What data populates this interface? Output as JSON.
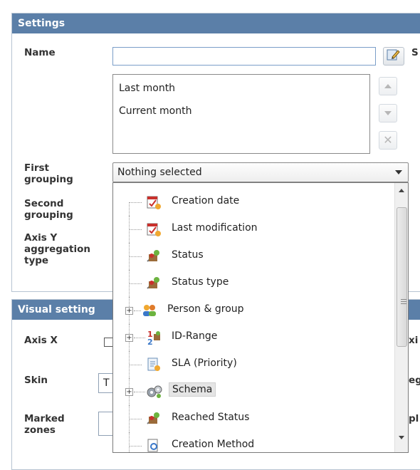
{
  "settings": {
    "title": "Settings",
    "name_label": "Name",
    "name_value": "",
    "clipped_right_label": "S",
    "list_items": [
      "Last month",
      "Current month"
    ],
    "first_grouping_label": "First grouping",
    "first_grouping_value": "Nothing selected",
    "second_grouping_label": "Second grouping",
    "axis_y_label": "Axis Y aggregation type"
  },
  "dropdown_options": [
    {
      "label": "Creation date",
      "icon": "calendar-check-icon",
      "expandable": false
    },
    {
      "label": "Last modification",
      "icon": "calendar-check-icon",
      "expandable": false
    },
    {
      "label": "Status",
      "icon": "status-flag-icon",
      "expandable": false
    },
    {
      "label": "Status type",
      "icon": "status-flag-icon",
      "expandable": false
    },
    {
      "label": "Person & group",
      "icon": "people-icon",
      "expandable": true
    },
    {
      "label": "ID-Range",
      "icon": "numbers-icon",
      "expandable": true
    },
    {
      "label": "SLA (Priority)",
      "icon": "sla-document-icon",
      "expandable": false
    },
    {
      "label": "Schema",
      "icon": "schema-gears-icon",
      "expandable": true,
      "selected": true
    },
    {
      "label": "Reached Status",
      "icon": "status-flag-icon",
      "expandable": false
    },
    {
      "label": "Creation Method",
      "icon": "document-search-icon",
      "expandable": false
    }
  ],
  "visual_settings": {
    "title": "Visual setting",
    "axis_x_label": "Axis X",
    "skin_label": "Skin",
    "skin_value": "T",
    "marked_zones_label": "Marked zones",
    "clipped_right_1": "xi",
    "clipped_right_2": "eg",
    "clipped_right_3": "pl"
  },
  "colors": {
    "header_bg": "#5b7fa8",
    "header_text": "#ffffff",
    "label_text": "#333333"
  }
}
